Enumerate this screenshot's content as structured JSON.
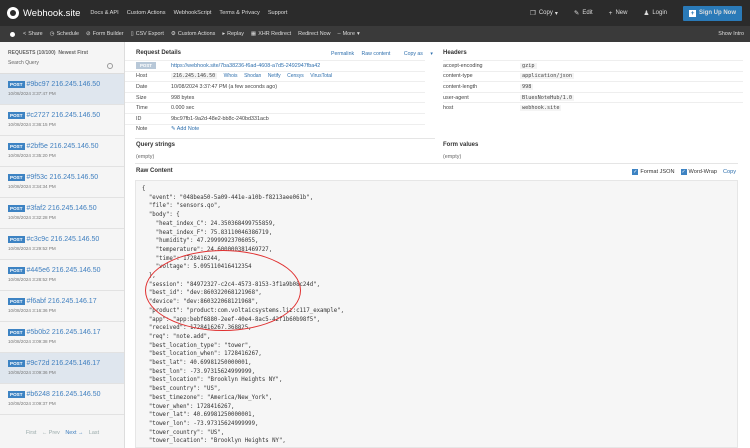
{
  "app": {
    "brand": "Webhook.site",
    "nav": [
      "Docs & API",
      "Custom Actions",
      "WebhookScript",
      "Terms & Privacy",
      "Support"
    ],
    "copy_label": "Copy",
    "edit_label": "Edit",
    "new_label": "New",
    "login_label": "Login",
    "signup_label": "Sign Up Now"
  },
  "actions": {
    "items": [
      {
        "icon": "share-icon",
        "label": "Share"
      },
      {
        "icon": "clock-icon",
        "label": "Schedule"
      },
      {
        "icon": "form-icon",
        "label": "Form Builder"
      },
      {
        "icon": "csv-icon",
        "label": "CSV Export"
      },
      {
        "icon": "gear-icon",
        "label": "Custom Actions"
      },
      {
        "icon": "play-icon",
        "label": "Replay"
      },
      {
        "icon": "redirect-icon",
        "label": "XHR Redirect"
      },
      {
        "icon": "",
        "label": "Redirect Now"
      },
      {
        "icon": "",
        "label": "More"
      }
    ],
    "show_intro": "Show Intro"
  },
  "sidebar": {
    "requests_label": "REQUESTS (10/100)",
    "sort_label": "Newest First",
    "search_label": "Search Query",
    "method": "POST",
    "requests": [
      {
        "title": "#9bc97 216.245.146.50",
        "ts": "10/08/2024 3:37:47 PM",
        "active": true
      },
      {
        "title": "#c2727 216.245.146.50",
        "ts": "10/08/2024 3:36:15 PM",
        "active": false
      },
      {
        "title": "#2bf5e 216.245.146.50",
        "ts": "10/08/2024 3:35:20 PM",
        "active": false
      },
      {
        "title": "#9f53c 216.245.146.50",
        "ts": "10/08/2024 3:34:34 PM",
        "active": false
      },
      {
        "title": "#3faf2 216.245.146.50",
        "ts": "10/08/2024 3:32:28 PM",
        "active": false
      },
      {
        "title": "#c3c9c 216.245.146.50",
        "ts": "10/08/2024 3:29:52 PM",
        "active": false
      },
      {
        "title": "#445e6 216.245.146.50",
        "ts": "10/08/2024 3:28:52 PM",
        "active": false
      },
      {
        "title": "#f6abf 216.245.146.17",
        "ts": "10/08/2024 3:16:36 PM",
        "active": false
      },
      {
        "title": "#5b0b2 216.245.146.17",
        "ts": "10/08/2024 3:09:38 PM",
        "active": false
      },
      {
        "title": "#9c72d 216.245.146.17",
        "ts": "10/08/2024 3:09:36 PM",
        "active": true
      },
      {
        "title": "#b6248 216.245.146.50",
        "ts": "10/08/2024 3:09:37 PM",
        "active": false
      }
    ],
    "pager": {
      "first": "First",
      "prev": "← Prev",
      "next": "Next →",
      "last": "Last"
    }
  },
  "details": {
    "title": "Request Details",
    "permalink": "Permalink",
    "raw_content": "Raw content",
    "copy_as": "Copy as",
    "method": "POST",
    "url": "https://webhook.site/7ba38236-f6ad-4608-a7d5-2492947fba42",
    "host_label": "Host",
    "host_ip": "216.245.146.50",
    "host_links": [
      "Whois",
      "Shodan",
      "Netify",
      "Censys",
      "VirusTotal"
    ],
    "date_label": "Date",
    "date": "10/08/2024 3:37:47 PM (a few seconds ago)",
    "size_label": "Size",
    "size": "998 bytes",
    "time_label": "Time",
    "time": "0.000 sec",
    "id_label": "ID",
    "id": "9bc97fb1-9a2d-48e2-bb8c-240bd331acb",
    "note_label": "Note",
    "add_note": "Add Note"
  },
  "headers": {
    "title": "Headers",
    "rows": [
      {
        "k": "accept-encoding",
        "v": "gzip"
      },
      {
        "k": "content-type",
        "v": "application/json"
      },
      {
        "k": "content-length",
        "v": "998"
      },
      {
        "k": "user-agent",
        "v": "BluesNoteHub/1.0"
      },
      {
        "k": "host",
        "v": "webhook.site"
      }
    ]
  },
  "query": {
    "title": "Query strings",
    "empty": "(empty)"
  },
  "form": {
    "title": "Form values",
    "empty": "(empty)"
  },
  "raw": {
    "title": "Raw Content",
    "format_json": "Format JSON",
    "word_wrap": "Word-Wrap",
    "copy": "Copy",
    "body": "{\n  \"event\": \"048bea50-5a09-441e-a10b-f8213aee061b\",\n  \"file\": \"sensors.qo\",\n  \"body\": {\n    \"heat_index_C\": 24.350368499755859,\n    \"heat_index_F\": 75.83110046386719,\n    \"humidity\": 47.29999923706055,\n    \"temperature\": 24.600000381469727,\n    \"time\": 1728416244,\n    \"voltage\": 5.095110416412354\n  },\n  \"session\": \"84972327-c2c4-4573-8153-3f1a9b08c24d\",\n  \"best_id\": \"dev:860322068121968\",\n  \"device\": \"dev:860322068121968\",\n  \"product\": \"product:com.voltaicsystems.liz:c117_example\",\n  \"app\": \"app:bebf6880-2eef-40e4-8ac5-42f1b60b98f5\",\n  \"received\": 1728416267.368825,\n  \"req\": \"note.add\",\n  \"best_location_type\": \"tower\",\n  \"best_location_when\": 1728416267,\n  \"best_lat\": 40.69981250000001,\n  \"best_lon\": -73.97315624999999,\n  \"best_location\": \"Brooklyn Heights NY\",\n  \"best_country\": \"US\",\n  \"best_timezone\": \"America/New_York\",\n  \"tower_when\": 1728416267,\n  \"tower_lat\": 40.69981250000001,\n  \"tower_lon\": -73.97315624999999,\n  \"tower_country\": \"US\",\n  \"tower_location\": \"Brooklyn Heights NY\",\n  \"tower_timezone\": \"America/New_York\","
  },
  "colors": {
    "accent": "#3d83c3",
    "highlight": "#e03030",
    "topbar": "#2b2b2b"
  }
}
